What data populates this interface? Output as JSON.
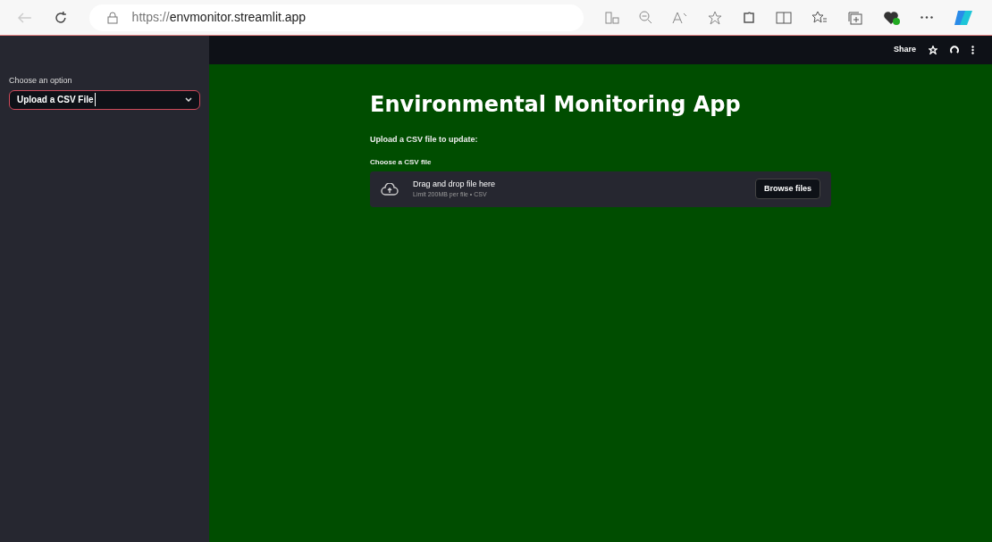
{
  "browser": {
    "url_scheme": "https://",
    "url_host": "envmonitor.streamlit.app"
  },
  "header": {
    "share": "Share"
  },
  "sidebar": {
    "label": "Choose an option",
    "select": {
      "value": "Upload a CSV File"
    }
  },
  "main": {
    "title": "Environmental Monitoring App",
    "subtitle": "Upload a CSV file to update:",
    "uploader": {
      "label": "Choose a CSV file",
      "instruction": "Drag and drop file here",
      "limit": "Limit 200MB per file • CSV",
      "button": "Browse files"
    }
  }
}
